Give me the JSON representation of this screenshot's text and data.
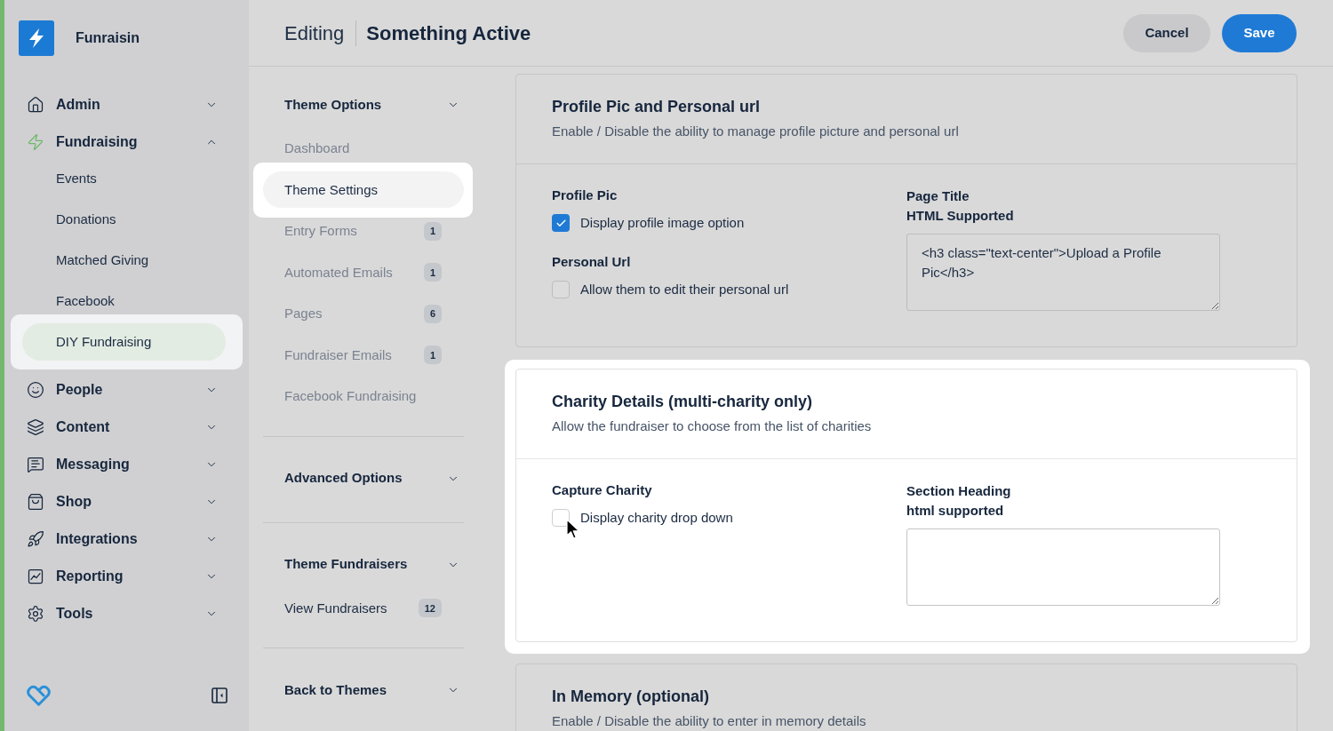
{
  "sidebar": {
    "brand": "Funraisin",
    "items": [
      {
        "label": "Admin",
        "expanded": false
      },
      {
        "label": "Fundraising",
        "expanded": true,
        "children": [
          {
            "label": "Events",
            "selected": false,
            "spotlight": false
          },
          {
            "label": "Donations",
            "selected": false,
            "spotlight": false
          },
          {
            "label": "Matched Giving",
            "selected": false,
            "spotlight": false
          },
          {
            "label": "Facebook",
            "selected": false,
            "spotlight": false
          },
          {
            "label": "DIY Fundraising",
            "selected": true,
            "spotlight": true
          }
        ]
      },
      {
        "label": "People",
        "expanded": false
      },
      {
        "label": "Content",
        "expanded": false
      },
      {
        "label": "Messaging",
        "expanded": false
      },
      {
        "label": "Shop",
        "expanded": false
      },
      {
        "label": "Integrations",
        "expanded": false
      },
      {
        "label": "Reporting",
        "expanded": false
      },
      {
        "label": "Tools",
        "expanded": false
      }
    ]
  },
  "header": {
    "mode": "Editing",
    "title": "Something Active",
    "buttons": [
      {
        "label": "Cancel",
        "kind": "secondary"
      },
      {
        "label": "Save",
        "kind": "primary"
      }
    ]
  },
  "theme_menu": {
    "sections": [
      {
        "title": "Theme Options",
        "items": [
          {
            "label": "Dashboard",
            "selected": false,
            "dimmed": true,
            "spotlight": false
          },
          {
            "label": "Theme Settings",
            "selected": true,
            "dimmed": false,
            "spotlight": true
          },
          {
            "label": "Entry Forms",
            "count": "1",
            "selected": false,
            "dimmed": true,
            "spotlight": false
          },
          {
            "label": "Automated Emails",
            "count": "1",
            "selected": false,
            "dimmed": true,
            "spotlight": false
          },
          {
            "label": "Pages",
            "count": "6",
            "selected": false,
            "dimmed": true,
            "spotlight": false
          },
          {
            "label": "Fundraiser Emails",
            "count": "1",
            "selected": false,
            "dimmed": true,
            "spotlight": false
          },
          {
            "label": "Facebook Fundraising",
            "selected": false,
            "dimmed": true,
            "spotlight": false
          }
        ]
      },
      {
        "title": "Advanced Options"
      },
      {
        "title": "Theme Fundraisers",
        "items": [
          {
            "label": "View Fundraisers",
            "count": "12",
            "selected": false,
            "dimmed": false,
            "spotlight": false
          }
        ]
      },
      {
        "title": "Back to Themes"
      }
    ]
  },
  "cards": [
    {
      "title": "Profile Pic and Personal url",
      "description": "Enable / Disable the ability to manage profile picture and personal url",
      "spotlight": false,
      "options": [
        {
          "label": "Profile Pic",
          "checkbox_label": "Display profile image option",
          "checked": true
        },
        {
          "label": "Personal Url",
          "checkbox_label": "Allow them to edit their personal url",
          "checked": false
        }
      ],
      "field": {
        "label": "Page Title",
        "note": "HTML Supported",
        "value": "<h3 class=\"text-center\">Upload a Profile Pic</h3>"
      }
    },
    {
      "title": "Charity Details (multi-charity only)",
      "description": "Allow the fundraiser to choose from the list of charities",
      "spotlight": true,
      "options": [
        {
          "label": "Capture Charity",
          "checkbox_label": "Display charity drop down",
          "checked": false
        }
      ],
      "field": {
        "label": "Section Heading",
        "note": "html supported"
      }
    },
    {
      "title": "In Memory (optional)",
      "description": "Enable / Disable the ability to enter in memory details",
      "spotlight": false
    }
  ]
}
